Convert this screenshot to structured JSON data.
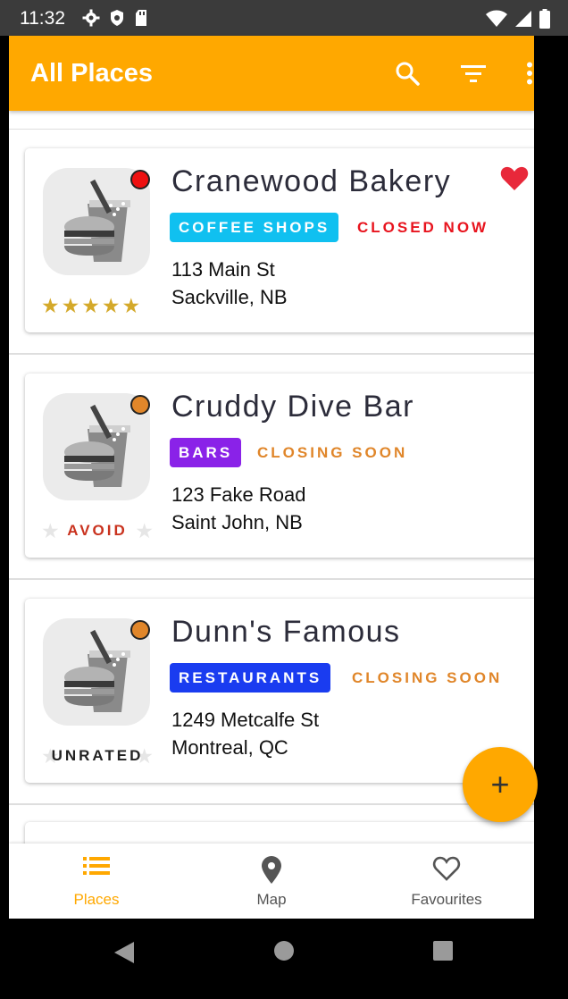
{
  "status_bar": {
    "time": "11:32"
  },
  "app_bar": {
    "title": "All Places"
  },
  "colors": {
    "accent": "#ffa800",
    "coffee": "#10c0f0",
    "bars": "#8a22e8",
    "restaurants": "#1a3cf0",
    "closed": "#e8141e",
    "closing": "#e0862a"
  },
  "places": [
    {
      "name": "Cranewood Bakery",
      "category": "COFFEE SHOPS",
      "status": "CLOSED NOW",
      "address_line1": "113 Main St",
      "address_line2": "Sackville, NB",
      "rating": 5,
      "rating_label": "",
      "favourite": true,
      "dot": "red"
    },
    {
      "name": "Cruddy Dive Bar",
      "category": "BARS",
      "status": "CLOSING SOON",
      "address_line1": "123 Fake Road",
      "address_line2": "Saint John, NB",
      "rating": 0,
      "rating_label": "AVOID",
      "favourite": false,
      "dot": "orange"
    },
    {
      "name": "Dunn's Famous",
      "category": "RESTAURANTS",
      "status": "CLOSING SOON",
      "address_line1": "1249 Metcalfe St",
      "address_line2": "Montreal, QC",
      "rating": 0,
      "rating_label": "UNRATED",
      "favourite": false,
      "dot": "orange"
    }
  ],
  "fab": {
    "label": "+"
  },
  "bottom_nav": [
    {
      "label": "Places",
      "icon": "list-icon",
      "active": true
    },
    {
      "label": "Map",
      "icon": "map-pin-icon",
      "active": false
    },
    {
      "label": "Favourites",
      "icon": "heart-outline-icon",
      "active": false
    }
  ]
}
